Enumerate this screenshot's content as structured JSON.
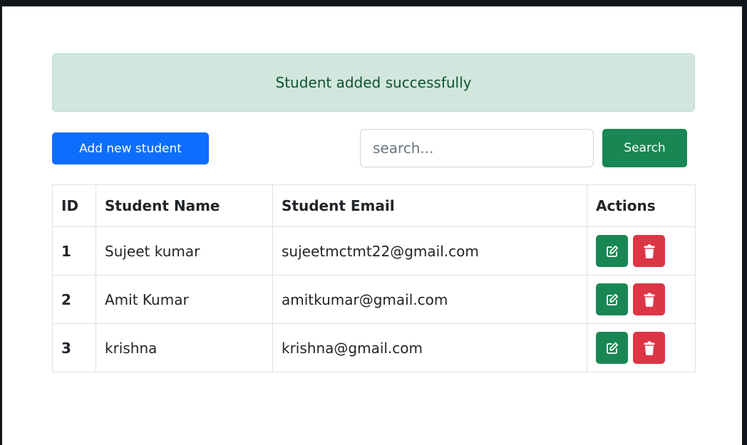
{
  "alert": {
    "message": "Student added successfully"
  },
  "toolbar": {
    "add_label": "Add new student",
    "search_placeholder": "search...",
    "search_value": "",
    "search_label": "Search"
  },
  "table": {
    "headers": [
      "ID",
      "Student Name",
      "Student Email",
      "Actions"
    ],
    "rows": [
      {
        "id": "1",
        "name": "Sujeet kumar",
        "email": "sujeetmctmt22@gmail.com"
      },
      {
        "id": "2",
        "name": "Amit Kumar",
        "email": "amitkumar@gmail.com"
      },
      {
        "id": "3",
        "name": "krishna",
        "email": "krishna@gmail.com"
      }
    ],
    "action_icons": [
      "edit-icon",
      "trash-icon"
    ]
  },
  "colors": {
    "primary": "#0d6efd",
    "success": "#198754",
    "danger": "#dc3545",
    "alert_bg": "#d1e7dd",
    "alert_text": "#0f5132"
  }
}
